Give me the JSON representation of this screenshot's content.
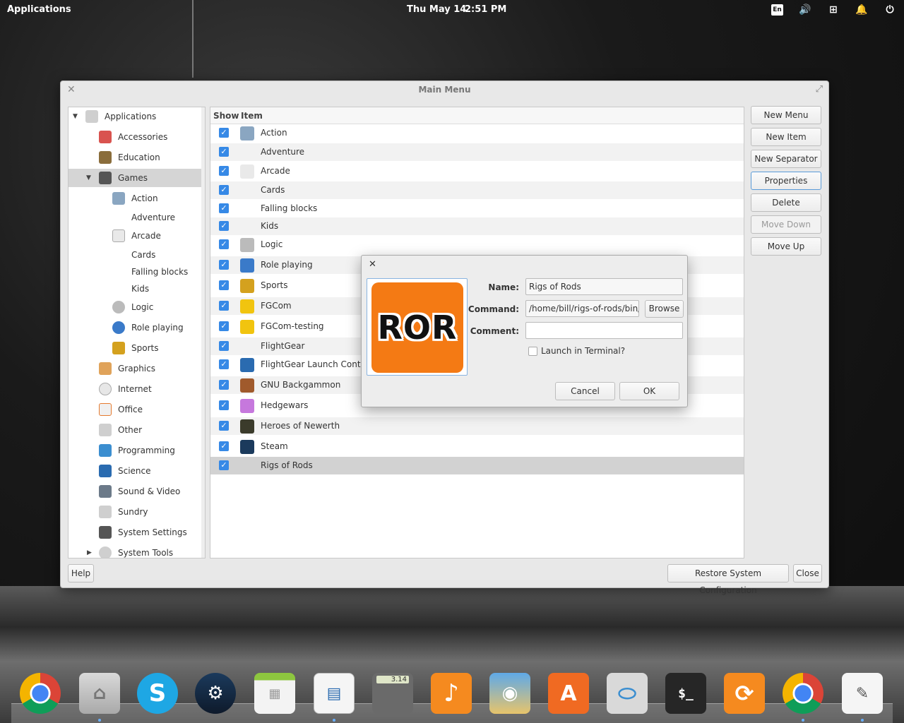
{
  "top_panel": {
    "applications_label": "Applications",
    "date": "Thu May 14",
    "time": "2:51 PM",
    "keyboard_layout": "En",
    "indicators": [
      "volume-icon",
      "network-icon",
      "notifications-icon",
      "power-icon"
    ]
  },
  "window": {
    "title": "Main Menu",
    "tree": {
      "root": "Applications",
      "items": [
        {
          "label": "Accessories",
          "icon": "accessories-icon"
        },
        {
          "label": "Education",
          "icon": "education-icon"
        },
        {
          "label": "Games",
          "icon": "games-icon",
          "selected": true
        },
        {
          "label": "Action",
          "icon": "action-icon"
        },
        {
          "label": "Adventure",
          "icon": ""
        },
        {
          "label": "Arcade",
          "icon": "arcade-icon"
        },
        {
          "label": "Cards",
          "icon": ""
        },
        {
          "label": "Falling blocks",
          "icon": ""
        },
        {
          "label": "Kids",
          "icon": ""
        },
        {
          "label": "Logic",
          "icon": "logic-icon"
        },
        {
          "label": "Role playing",
          "icon": "role-playing-icon"
        },
        {
          "label": "Sports",
          "icon": "sports-icon"
        },
        {
          "label": "Graphics",
          "icon": "graphics-icon"
        },
        {
          "label": "Internet",
          "icon": "internet-icon"
        },
        {
          "label": "Office",
          "icon": "office-icon"
        },
        {
          "label": "Other",
          "icon": "other-icon"
        },
        {
          "label": "Programming",
          "icon": "programming-icon"
        },
        {
          "label": "Science",
          "icon": "science-icon"
        },
        {
          "label": "Sound & Video",
          "icon": "sound-video-icon"
        },
        {
          "label": "Sundry",
          "icon": "sundry-icon"
        },
        {
          "label": "System Settings",
          "icon": "system-settings-icon"
        },
        {
          "label": "System Tools",
          "icon": "system-tools-icon"
        }
      ]
    },
    "list": {
      "col_show": "Show",
      "col_item": "Item",
      "rows": [
        {
          "label": "Action",
          "checked": true
        },
        {
          "label": "Adventure",
          "checked": true
        },
        {
          "label": "Arcade",
          "checked": true
        },
        {
          "label": "Cards",
          "checked": true
        },
        {
          "label": "Falling blocks",
          "checked": true
        },
        {
          "label": "Kids",
          "checked": true
        },
        {
          "label": "Logic",
          "checked": true
        },
        {
          "label": "Role playing",
          "checked": true
        },
        {
          "label": "Sports",
          "checked": true
        },
        {
          "label": "FGCom",
          "checked": true
        },
        {
          "label": "FGCom-testing",
          "checked": true
        },
        {
          "label": "FlightGear",
          "checked": true
        },
        {
          "label": "FlightGear Launch Control",
          "checked": true
        },
        {
          "label": "GNU Backgammon",
          "checked": true
        },
        {
          "label": "Hedgewars",
          "checked": true
        },
        {
          "label": "Heroes of Newerth",
          "checked": true
        },
        {
          "label": "Steam",
          "checked": true
        },
        {
          "label": "Rigs of Rods",
          "checked": true,
          "selected": true
        }
      ]
    },
    "buttons": {
      "new_menu": "New Menu",
      "new_item": "New Item",
      "new_separator": "New Separator",
      "properties": "Properties",
      "delete": "Delete",
      "move_down": "Move Down",
      "move_up": "Move Up",
      "help": "Help",
      "restore": "Restore System Configuration",
      "close": "Close"
    }
  },
  "dialog": {
    "icon_text": "ROR",
    "name_label": "Name:",
    "name_value": "Rigs of Rods",
    "command_label": "Command:",
    "command_value": "/home/bill/rigs-of-rods/bin/R",
    "browse": "Browse",
    "comment_label": "Comment:",
    "comment_value": "",
    "terminal_label": "Launch in Terminal?",
    "terminal_checked": false,
    "cancel": "Cancel",
    "ok": "OK"
  },
  "dock": {
    "calculator_display": "3.14",
    "apps": [
      "chrome-icon",
      "files-icon",
      "skype-icon",
      "steam-icon",
      "calendar-icon",
      "writer-icon",
      "calculator-icon",
      "music-icon",
      "photos-icon",
      "app-center-icon",
      "switchboard-icon",
      "terminal-icon",
      "update-icon",
      "chrome-icon",
      "notes-icon"
    ]
  }
}
